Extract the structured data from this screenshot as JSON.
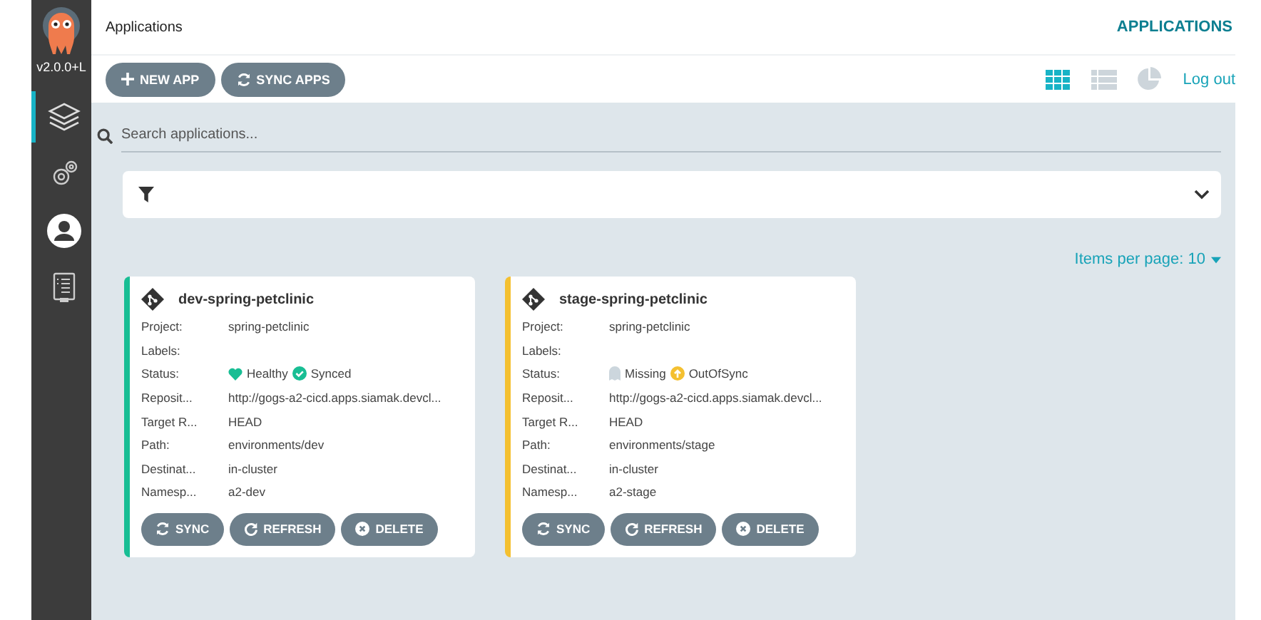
{
  "sidebar": {
    "version": "v2.0.0+L",
    "items": [
      {
        "kind": "layers",
        "selected": true
      },
      {
        "kind": "gears",
        "selected": false
      },
      {
        "kind": "user",
        "selected": false
      },
      {
        "kind": "docs",
        "selected": false
      }
    ]
  },
  "header": {
    "breadcrumb": "Applications",
    "title": "APPLICATIONS"
  },
  "toolbar": {
    "buttons": [
      {
        "kind": "plus",
        "label": "NEW APP"
      },
      {
        "kind": "sync",
        "label": "SYNC APPS"
      }
    ],
    "views": [
      {
        "kind": "tiles",
        "selected": true
      },
      {
        "kind": "list",
        "selected": false
      },
      {
        "kind": "summary",
        "selected": false
      }
    ],
    "logout": "Log out"
  },
  "search": {
    "placeholder": "Search applications..."
  },
  "pagination": {
    "label": "Items per page: 10"
  },
  "apps": [
    {
      "name": "dev-spring-petclinic",
      "color": "#18be94",
      "fields": [
        {
          "label": "Project:",
          "value": "spring-petclinic"
        },
        {
          "label": "Labels:"
        },
        {
          "label": "Status:",
          "kind": "status"
        },
        {
          "label": "Reposit...",
          "value": "http://gogs-a2-cicd.apps.siamak.devcl..."
        },
        {
          "label": "Target R...",
          "value": "HEAD"
        },
        {
          "label": "Path:",
          "value": "environments/dev"
        },
        {
          "label": "Destinat...",
          "value": "in-cluster"
        },
        {
          "label": "Namesp...",
          "value": "a2-dev"
        }
      ],
      "health": {
        "kind": "healthy",
        "label": "Healthy"
      },
      "sync": {
        "kind": "synced",
        "label": "Synced"
      },
      "actions": [
        {
          "kind": "sync",
          "label": "SYNC"
        },
        {
          "kind": "refresh",
          "label": "REFRESH"
        },
        {
          "kind": "delete",
          "label": "DELETE"
        }
      ]
    },
    {
      "name": "stage-spring-petclinic",
      "color": "#f4c030",
      "fields": [
        {
          "label": "Project:",
          "value": "spring-petclinic"
        },
        {
          "label": "Labels:"
        },
        {
          "label": "Status:",
          "kind": "status"
        },
        {
          "label": "Reposit...",
          "value": "http://gogs-a2-cicd.apps.siamak.devcl..."
        },
        {
          "label": "Target R...",
          "value": "HEAD"
        },
        {
          "label": "Path:",
          "value": "environments/stage"
        },
        {
          "label": "Destinat...",
          "value": "in-cluster"
        },
        {
          "label": "Namesp...",
          "value": "a2-stage"
        }
      ],
      "health": {
        "kind": "missing",
        "label": "Missing"
      },
      "sync": {
        "kind": "outofsync",
        "label": "OutOfSync"
      },
      "actions": [
        {
          "kind": "sync",
          "label": "SYNC"
        },
        {
          "kind": "refresh",
          "label": "REFRESH"
        },
        {
          "kind": "delete",
          "label": "DELETE"
        }
      ]
    }
  ]
}
